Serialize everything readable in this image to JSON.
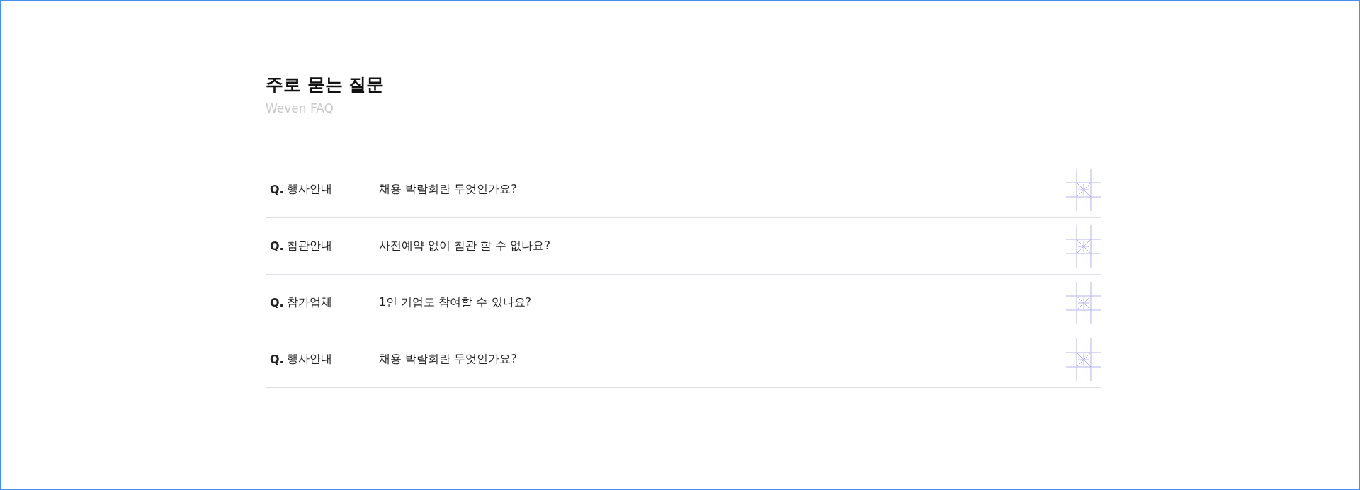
{
  "heading": {
    "title": "주로 묻는 질문",
    "subtitle": "Weven FAQ"
  },
  "faq": [
    {
      "prefix": "Q.",
      "category": "행사안내",
      "question": "채용 박람회란 무엇인가요?",
      "expanded": false
    },
    {
      "prefix": "Q.",
      "category": "참관안내",
      "question": "사전예약 없이 참관 할 수 없나요?",
      "expanded": false
    },
    {
      "prefix": "Q.",
      "category": "참가업체",
      "question": "1인 기업도 참여할 수 있나요?",
      "expanded": false
    },
    {
      "prefix": "Q.",
      "category": "행사안내",
      "question": "채용 박람회란 무엇인가요?",
      "expanded": false
    }
  ]
}
